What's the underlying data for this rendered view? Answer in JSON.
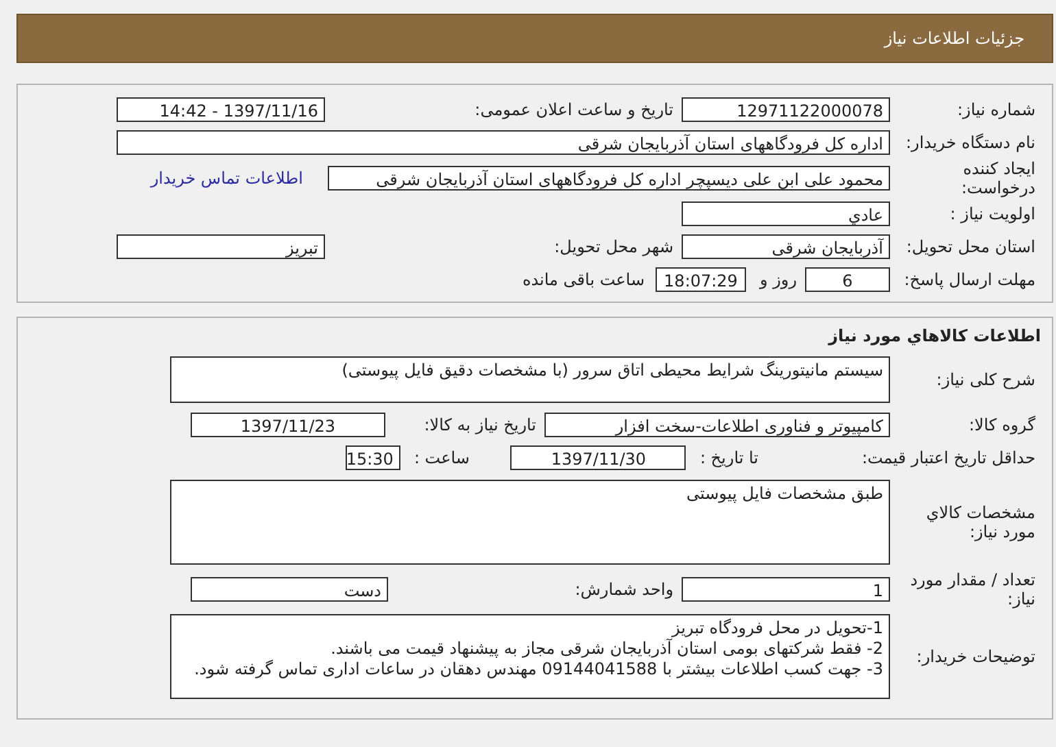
{
  "header": {
    "title": "جزئيات اطلاعات نياز"
  },
  "details": {
    "need_number": {
      "label": "شماره نياز:",
      "value": "12971122000078"
    },
    "announce": {
      "label": "تاريخ و ساعت اعلان عمومی:",
      "value": "1397/11/16 - 14:42"
    },
    "buyer_org": {
      "label": "نام دستگاه خريدار:",
      "value": "اداره کل فرودگاههای استان آذربايجان شرقی"
    },
    "requester": {
      "label": "ايجاد کننده درخواست:",
      "value": "محمود علی ابن علی دیسپچر اداره کل فرودگاههای استان آذربایجان شرقی",
      "link": "اطلاعات تماس خريدار"
    },
    "priority": {
      "label": "اولويت نياز :",
      "value": "عادي"
    },
    "province": {
      "label": "استان محل تحویل:",
      "value": "آذربايجان شرقی"
    },
    "city": {
      "label": "شهر محل تحویل:",
      "value": "تبريز"
    },
    "deadline": {
      "label": "مهلت ارسال پاسخ:",
      "days": "6",
      "days_label": "روز و",
      "time": "18:07:29",
      "remaining_label": "ساعت باقی مانده"
    }
  },
  "goods": {
    "title": "اطلاعات كالاهاي مورد نياز",
    "summary": {
      "label": "شرح کلی نياز:",
      "value": "سیستم مانیتورینگ شرایط محیطی اتاق سرور (با مشخصات دقیق فایل پیوستی)"
    },
    "group": {
      "label": "گروه کالا:",
      "value": "کامپیوتر و فناوری اطلاعات-سخت افزار"
    },
    "need_date": {
      "label": "تاريخ نياز به کالا:",
      "value": "1397/11/23"
    },
    "price_validity": {
      "label": "حداقل تاريخ اعتبار قيمت:",
      "to_label": "تا تاريخ :",
      "date": "1397/11/30",
      "time_label": "ساعت :",
      "time": "15:30"
    },
    "specs": {
      "label": "مشخصات کالاي مورد نياز:",
      "value": "طبق مشخصات فایل پیوستی"
    },
    "quantity": {
      "label": "تعداد / مقدار مورد نياز:",
      "value": "1"
    },
    "unit": {
      "label": "واحد شمارش:",
      "value": "دست"
    },
    "notes": {
      "label": "توضيحات خريدار:",
      "lines": [
        "1-تحویل در محل فرودگاه تبریز",
        "2- فقط شرکتهای بومی استان آذربایجان شرقی مجاز به پیشنهاد قیمت می باشند.",
        "3- جهت کسب اطلاعات بیشتر با 09144041588 مهندس دهقان در ساعات اداری تماس گرفته شود."
      ]
    }
  }
}
